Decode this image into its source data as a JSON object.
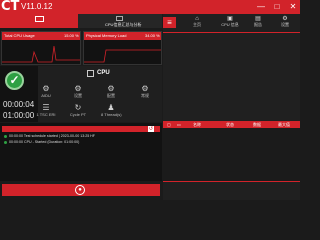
{
  "titlebar": {
    "logo": "CT",
    "version": "V11.0.12",
    "minimize": "—",
    "maximize": "□",
    "close": "✕"
  },
  "left_tabs": [
    {
      "label": "",
      "icon": "monitor-icon"
    },
    {
      "label": "CPU信息汇总与分析",
      "icon": "grid-icon"
    }
  ],
  "graphs": {
    "cpu_usage": {
      "label": "Total CPU Usage",
      "value": "15.00 %"
    },
    "memory": {
      "label": "Physical Memory Load",
      "value": "34.00 %"
    }
  },
  "status": {
    "icon": "check-icon",
    "timer_1": "00:00:04",
    "timer_2": "01:00:00"
  },
  "cpu_section": {
    "title": "CPU"
  },
  "tools": [
    {
      "label": "AIDU",
      "icon": "gear-icon"
    },
    {
      "label": "设置",
      "icon": "gear-icon"
    },
    {
      "label": "配置",
      "icon": "gear-icon"
    },
    {
      "label": "常规",
      "icon": "gear-icon"
    },
    {
      "label": "1 TSC ERI",
      "icon": "list-icon"
    },
    {
      "label": "Cycle PT",
      "icon": "refresh-icon"
    },
    {
      "label": "8 Thread(s)",
      "icon": "user-icon"
    }
  ],
  "log": {
    "lines": [
      "00:00:00   Test schedule started | 2023-00-00 13:25 HF",
      "00:00:00   CPU - Started (Duration: 01:00:00)"
    ]
  },
  "start_button": {
    "icon": "stop-icon"
  },
  "right_tabs": [
    {
      "label": "主页",
      "icon": "home-icon"
    },
    {
      "label": "CPU 信息",
      "icon": "cpu-icon"
    },
    {
      "label": "报告",
      "icon": "chart-icon"
    },
    {
      "label": "设置",
      "icon": "gear-icon"
    }
  ],
  "right_table": {
    "columns": [
      "",
      "",
      "名称",
      "状态",
      "数据",
      "最大值"
    ]
  }
}
